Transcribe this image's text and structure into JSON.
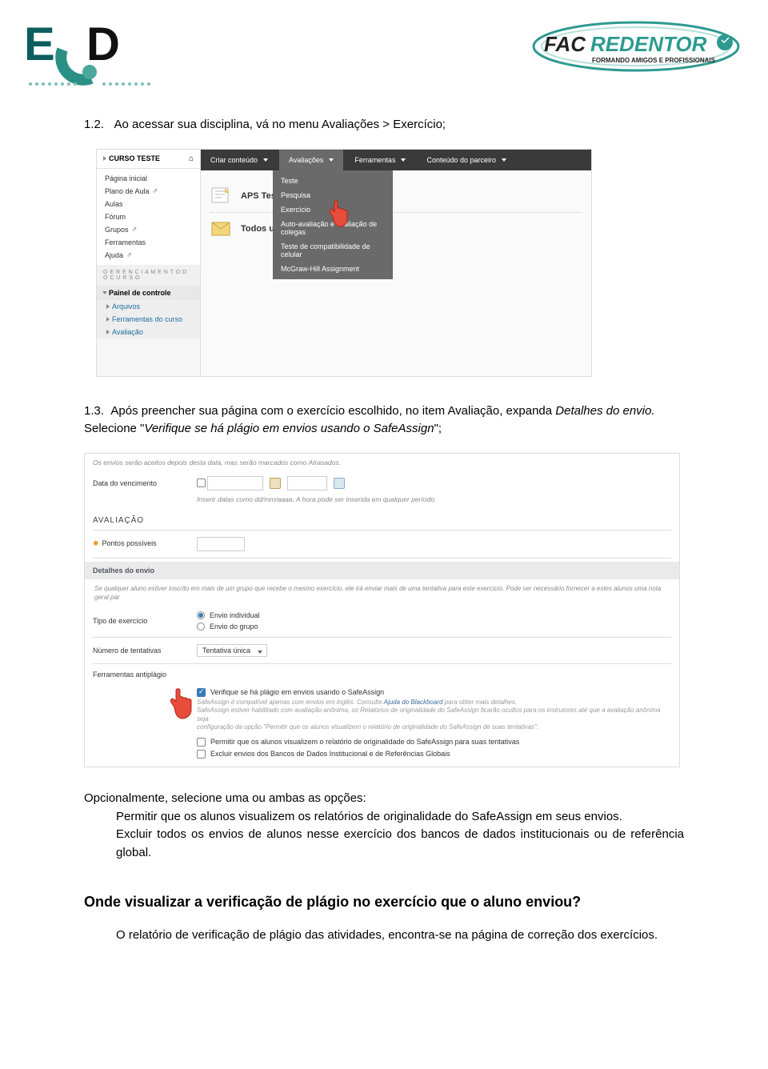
{
  "logos": {
    "left_main": "E.",
    "left_sub": "D",
    "right_fac": "FAC",
    "right_red": "REDENTOR",
    "right_tag": "FORMANDO AMIGOS E PROFISSIONAIS"
  },
  "step1_2": {
    "num": "1.2.",
    "text": "Ao acessar sua disciplina, vá no menu Avaliações > Exercício;"
  },
  "s1": {
    "course": "CURSO TESTE",
    "sidebar": [
      "Página inicial",
      "Plano de Aula",
      "Aulas",
      "Fórum",
      "Grupos",
      "Ferramentas",
      "Ajuda"
    ],
    "mgmt": "G E R E N C I A M E N T O   D O   C U R S O",
    "panel": "Painel de controle",
    "subs": [
      "Arquivos",
      "Ferramentas do curso",
      "Avaliação"
    ],
    "toolbar": [
      "Criar conteúdo",
      "Avaliações",
      "Ferramentas",
      "Conteúdo do parceiro"
    ],
    "dropdown": [
      "Teste",
      "Pesquisa",
      "Exercício",
      "Auto-avaliação e avaliação de colegas",
      "Teste de compatibilidade de celular",
      "McGraw-Hill Assignment"
    ],
    "link1": "APS Teste",
    "link2": "Todos us"
  },
  "step1_3": {
    "num": "1.3.",
    "line1": "Após preencher sua página com o exercício escolhido, no item Avaliação, expanda ",
    "em1": "Detalhes do envio.",
    "line2": " Selecione \"",
    "em2": "Verifique se há plágio em envios usando o SafeAssign",
    "line3": "\";"
  },
  "s2": {
    "note_top": "Os envios serão aceitos depois desta data, mas serão marcados como Atrasados.",
    "due_label": "Data do vencimento",
    "due_hint": "Inserir datas como dd/mm/aaaa. A hora pode ser inserida em qualquer período.",
    "section": "AVALIAÇÃO",
    "points_label": "Pontos possíveis",
    "details": "Detalhes do envio",
    "details_info": "Se qualquer aluno estiver inscrito em mais de um grupo que recebe o mesmo exercício, ele irá enviar mais de uma tentativa para este exercício. Pode ser necessário fornecer a estes alunos uma nota geral par",
    "type_label": "Tipo de exercício",
    "type_opt1": "Envio individual",
    "type_opt2": "Envio do grupo",
    "tries_label": "Número de tentativas",
    "tries_value": "Tentativa única",
    "tools_label": "Ferramentas antiplágio",
    "cb_main": "Verifique se há plágio em envios usando o SafeAssign",
    "gray1": "SafeAssign é compatível apenas com envios em inglês. Consulte ",
    "gray_link": "Ajuda do Blackboard",
    "gray1b": " para obter mais detalhes.",
    "gray2": "SafeAssign estiver habilitado com avaliação anônima, os Relatórios de originalidade do SafeAssign ficarão ocultos para os instrutores até que a avaliação anônima seja",
    "gray3": "configuração da opção \"Permitir que os alunos visualizem o relatório de originalidade do SafeAssign de suas tentativas\".",
    "cb_opt1": "Permitir que os alunos visualizem o relatório de originalidade do SafeAssign para suas tentativas",
    "cb_opt2": "Excluir envios dos Bancos de Dados Institucional e de Referências Globais"
  },
  "options": {
    "intro": "Opcionalmente, selecione uma ou ambas as opções:",
    "o1": "Permitir que os alunos visualizem os relatórios de originalidade do SafeAssign em seus envios.",
    "o2": "Excluir todos os envios de alunos nesse exercício dos bancos de dados institucionais ou de referência global."
  },
  "heading2": "Onde visualizar a verificação de plágio no exercício que o aluno enviou?",
  "para2": "O relatório de verificação de plágio das atividades, encontra-se na página de correção dos exercícios."
}
